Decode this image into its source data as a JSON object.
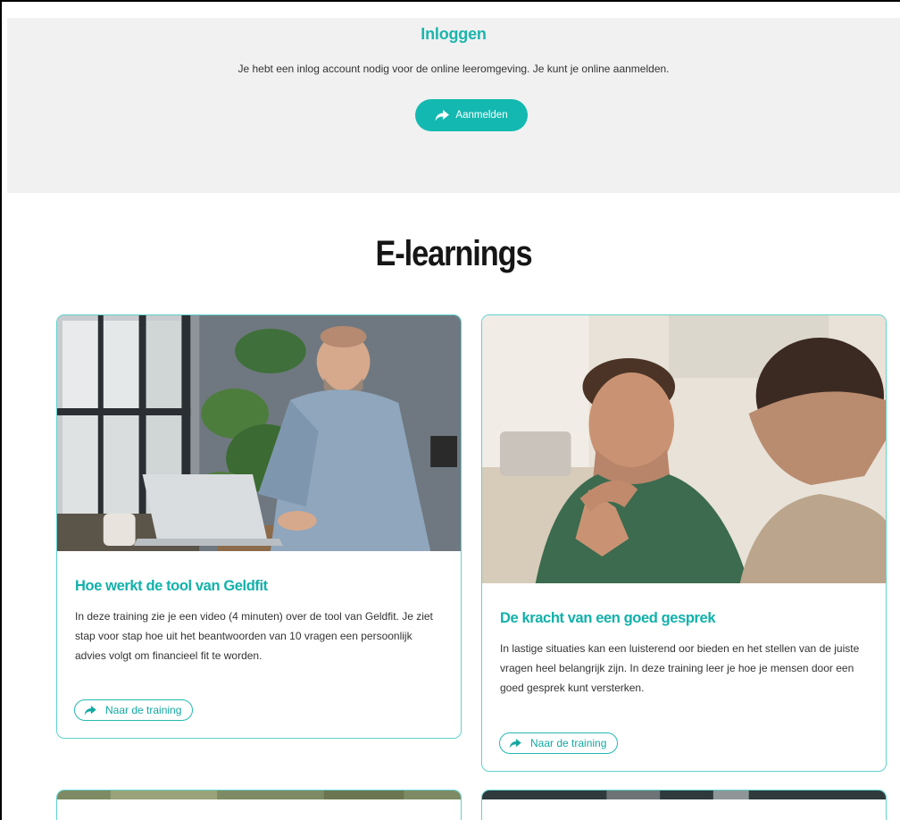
{
  "login": {
    "title": "Inloggen",
    "text": "Je hebt een inlog account nodig voor de online leeromgeving. Je kunt je online aanmelden.",
    "button_label": "Aanmelden",
    "button_icon": "share-arrow-icon"
  },
  "section": {
    "title": "E-learnings"
  },
  "cards": [
    {
      "title": "Hoe werkt de tool van Geldfit",
      "description": "In deze training zie je een video (4 minuten) over de tool van Geldfit. Je ziet stap voor stap hoe uit het beantwoorden van 10 vragen een persoonlijk advies volgt om financieel fit te worden.",
      "button_label": "Naar de training"
    },
    {
      "title": "De kracht van een goed gesprek",
      "description": "In lastige situaties kan een luisterend oor bieden en het stellen van de juiste vragen heel belangrijk zijn. In deze training leer je hoe je mensen door een goed gesprek kunt versterken.",
      "button_label": "Naar de training"
    }
  ],
  "colors": {
    "accent": "#13b9b0",
    "card_border": "#5fd3cd",
    "login_bg": "#f1f1f1"
  }
}
